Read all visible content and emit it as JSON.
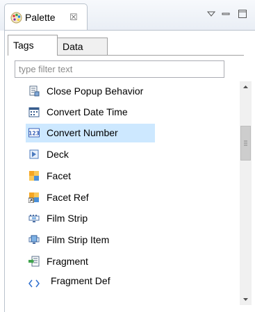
{
  "view": {
    "title": "Palette",
    "close_glyph": "☒"
  },
  "tabs": [
    {
      "label": "Tags",
      "active": true
    },
    {
      "label": "Data",
      "active": false
    }
  ],
  "filter": {
    "placeholder": "type filter text",
    "value": ""
  },
  "tree": {
    "items": [
      {
        "label": "Close Popup Behavior",
        "icon": "close-popup-behavior-icon"
      },
      {
        "label": "Convert Date Time",
        "icon": "calendar-icon"
      },
      {
        "label": "Convert Number",
        "icon": "number-icon",
        "selected": true
      },
      {
        "label": "Deck",
        "icon": "deck-icon"
      },
      {
        "label": "Facet",
        "icon": "facet-icon"
      },
      {
        "label": "Facet Ref",
        "icon": "facet-ref-icon"
      },
      {
        "label": "Film Strip",
        "icon": "film-strip-icon"
      },
      {
        "label": "Film Strip Item",
        "icon": "film-strip-item-icon"
      },
      {
        "label": "Fragment",
        "icon": "fragment-icon"
      },
      {
        "label": "Fragment Def",
        "icon": "fragment-def-icon"
      }
    ]
  },
  "colors": {
    "selection": "#cde8ff",
    "scrollbar_thumb": "#cdcdcd"
  }
}
